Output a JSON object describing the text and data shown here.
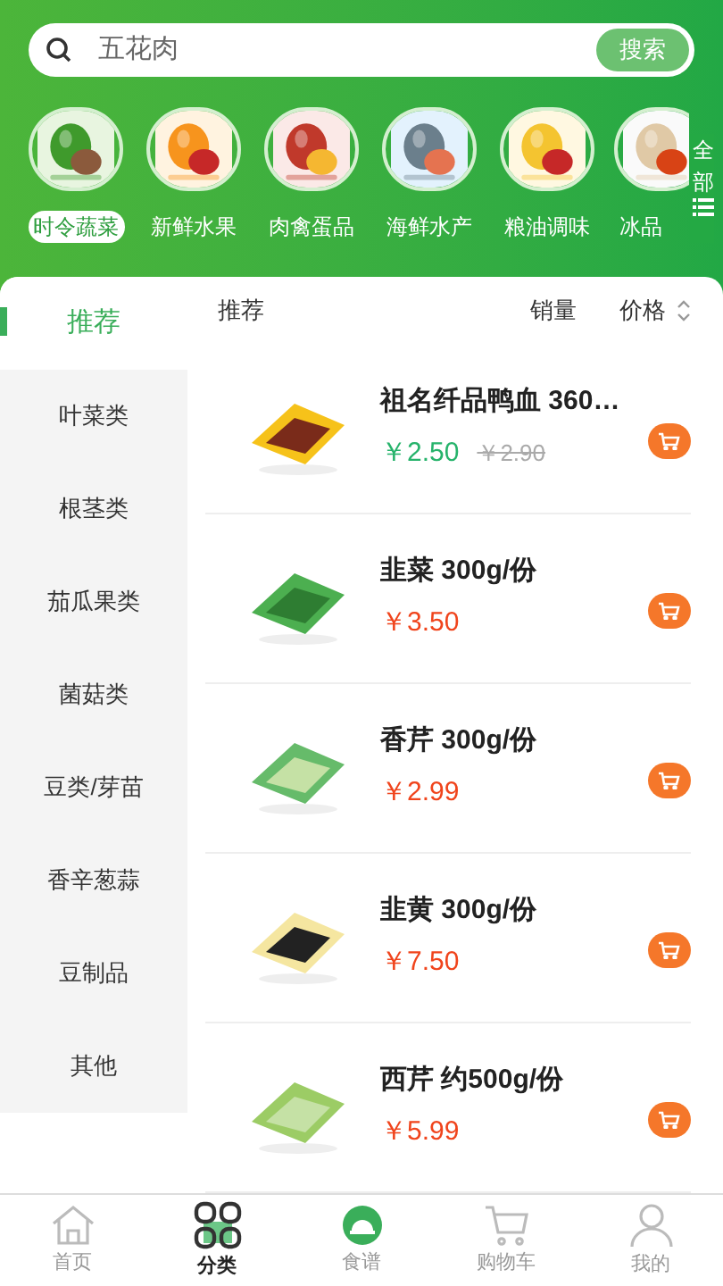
{
  "search": {
    "placeholder": "五花肉",
    "button": "搜索"
  },
  "categories": [
    {
      "label": "时令蔬菜",
      "selected": true
    },
    {
      "label": "新鲜水果",
      "selected": false
    },
    {
      "label": "肉禽蛋品",
      "selected": false
    },
    {
      "label": "海鲜水产",
      "selected": false
    },
    {
      "label": "粮油调味",
      "selected": false
    },
    {
      "label": "冰品",
      "selected": false
    }
  ],
  "all_button": "全部",
  "sidebar": [
    {
      "label": "推荐",
      "selected": true
    },
    {
      "label": "叶菜类",
      "selected": false
    },
    {
      "label": "根茎类",
      "selected": false
    },
    {
      "label": "茄瓜果类",
      "selected": false
    },
    {
      "label": "菌菇类",
      "selected": false
    },
    {
      "label": "豆类/芽苗",
      "selected": false
    },
    {
      "label": "香辛葱蒜",
      "selected": false
    },
    {
      "label": "豆制品",
      "selected": false
    },
    {
      "label": "其他",
      "selected": false
    }
  ],
  "sort": [
    {
      "label": "推荐",
      "kind": "plain"
    },
    {
      "label": "销量",
      "kind": "plain"
    },
    {
      "label": "价格",
      "kind": "sortable"
    }
  ],
  "products": [
    {
      "name": "祖名纤品鸭血 360…",
      "price": "￥2.50",
      "original_price": "￥2.90"
    },
    {
      "name": "韭菜 300g/份",
      "price": "￥3.50"
    },
    {
      "name": "香芹 300g/份",
      "price": "￥2.99"
    },
    {
      "name": "韭黄 300g/份",
      "price": "￥7.50"
    },
    {
      "name": "西芹 约500g/份",
      "price": "￥5.99"
    }
  ],
  "nav": [
    {
      "label": "首页",
      "kind": "home",
      "selected": false
    },
    {
      "label": "分类",
      "kind": "category",
      "selected": true
    },
    {
      "label": "食谱",
      "kind": "recipe",
      "selected": false
    },
    {
      "label": "购物车",
      "kind": "cart",
      "selected": false
    },
    {
      "label": "我的",
      "kind": "user",
      "selected": false
    }
  ]
}
